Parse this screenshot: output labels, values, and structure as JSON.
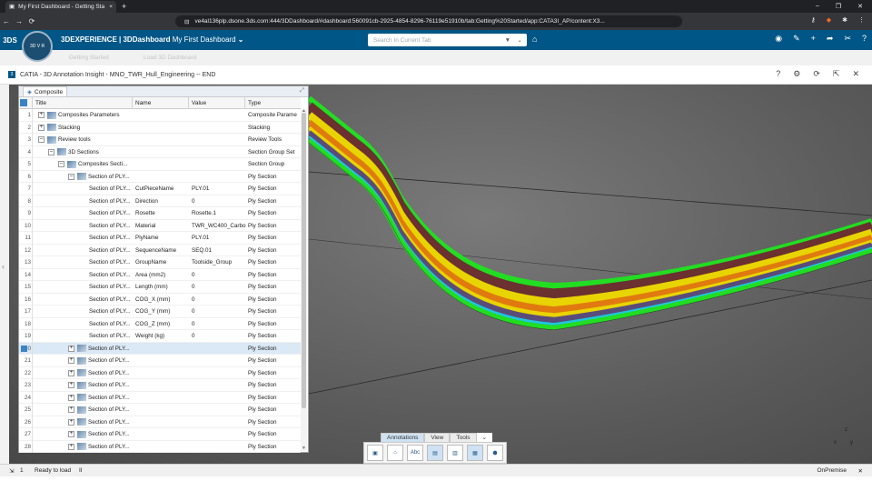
{
  "browser": {
    "tab_title": "My First Dashboard - Getting Sta",
    "tab_close": "×",
    "new_tab": "+",
    "url": "ve4al136plp.dsone.3ds.com:444/3DDashboard/#dashboard:560091cb-2925-4854-8296-76119e51910b/tab:Getting%20Started/app:CATA3I_AP/content:X3...",
    "minimize": "–",
    "maximize": "❐",
    "close": "✕"
  },
  "header": {
    "ds_logo": "3DS",
    "compass_label": "3D V R",
    "brand": "3DEXPERIENCE | 3DDashboard",
    "dashboard_name": "My First Dashboard",
    "search_placeholder": "Search In Current Tab"
  },
  "dashboard_tabs": {
    "tab1": "Getting Started",
    "tab2": "Load 3D Dashboard"
  },
  "app": {
    "title": "CATIA - 3D Annotation Insight - MNO_TWR_Hull_Engineering -- END",
    "help": "?",
    "settings": "⚙",
    "refresh": "⟳",
    "pin": "⇱",
    "close": "✕"
  },
  "panel": {
    "tab": "Composite",
    "columns": [
      "Title",
      "Name",
      "Value",
      "Type"
    ],
    "rows": [
      {
        "num": "1",
        "title": "Composites Parameters",
        "name": "",
        "value": "",
        "type": "Composite Parame",
        "level": 1,
        "expander": "+"
      },
      {
        "num": "2",
        "title": "Stacking",
        "name": "",
        "value": "",
        "type": "Stacking",
        "level": 1,
        "expander": "+"
      },
      {
        "num": "3",
        "title": "Review tools",
        "name": "",
        "value": "",
        "type": "Review Tools",
        "level": 1,
        "expander": "–"
      },
      {
        "num": "4",
        "title": "3D Sections",
        "name": "",
        "value": "",
        "type": "Section Group Set",
        "level": 2,
        "expander": "–"
      },
      {
        "num": "5",
        "title": "Composites Secti...",
        "name": "",
        "value": "",
        "type": "Section Group",
        "level": 3,
        "expander": "–"
      },
      {
        "num": "6",
        "title": "Section of PLY...",
        "name": "",
        "value": "",
        "type": "Ply Section",
        "level": 4,
        "expander": "–"
      },
      {
        "num": "7",
        "title": "Section of PLY...",
        "name": "CutPieceName",
        "value": "PLY.01",
        "type": "Ply Section",
        "level": 5,
        "expander": ""
      },
      {
        "num": "8",
        "title": "Section of PLY...",
        "name": "Direction",
        "value": "0",
        "type": "Ply Section",
        "level": 5,
        "expander": ""
      },
      {
        "num": "9",
        "title": "Section of PLY...",
        "name": "Rosette",
        "value": "Rosette.1",
        "type": "Ply Section",
        "level": 5,
        "expander": ""
      },
      {
        "num": "10",
        "title": "Section of PLY...",
        "name": "Material",
        "value": "TWR_WC400_Carbo",
        "type": "Ply Section",
        "level": 5,
        "expander": ""
      },
      {
        "num": "11",
        "title": "Section of PLY...",
        "name": "PlyName",
        "value": "PLY.01",
        "type": "Ply Section",
        "level": 5,
        "expander": ""
      },
      {
        "num": "12",
        "title": "Section of PLY...",
        "name": "SequenceName",
        "value": "SEQ.01",
        "type": "Ply Section",
        "level": 5,
        "expander": ""
      },
      {
        "num": "13",
        "title": "Section of PLY...",
        "name": "GroupName",
        "value": "Toolside_Group",
        "type": "Ply Section",
        "level": 5,
        "expander": ""
      },
      {
        "num": "14",
        "title": "Section of PLY...",
        "name": "Area (mm2)",
        "value": "0",
        "type": "Ply Section",
        "level": 5,
        "expander": ""
      },
      {
        "num": "15",
        "title": "Section of PLY...",
        "name": "Length (mm)",
        "value": "0",
        "type": "Ply Section",
        "level": 5,
        "expander": ""
      },
      {
        "num": "16",
        "title": "Section of PLY...",
        "name": "COG_X (mm)",
        "value": "0",
        "type": "Ply Section",
        "level": 5,
        "expander": ""
      },
      {
        "num": "17",
        "title": "Section of PLY...",
        "name": "COG_Y (mm)",
        "value": "0",
        "type": "Ply Section",
        "level": 5,
        "expander": ""
      },
      {
        "num": "18",
        "title": "Section of PLY...",
        "name": "COG_Z (mm)",
        "value": "0",
        "type": "Ply Section",
        "level": 5,
        "expander": ""
      },
      {
        "num": "19",
        "title": "Section of PLY...",
        "name": "Weight (kg)",
        "value": "0",
        "type": "Ply Section",
        "level": 5,
        "expander": ""
      },
      {
        "num": "20",
        "title": "Section of PLY...",
        "name": "",
        "value": "",
        "type": "Ply Section",
        "level": 4,
        "expander": "+",
        "selected": true
      },
      {
        "num": "21",
        "title": "Section of PLY...",
        "name": "",
        "value": "",
        "type": "Ply Section",
        "level": 4,
        "expander": "+"
      },
      {
        "num": "22",
        "title": "Section of PLY...",
        "name": "",
        "value": "",
        "type": "Ply Section",
        "level": 4,
        "expander": "+"
      },
      {
        "num": "23",
        "title": "Section of PLY...",
        "name": "",
        "value": "",
        "type": "Ply Section",
        "level": 4,
        "expander": "+"
      },
      {
        "num": "24",
        "title": "Section of PLY...",
        "name": "",
        "value": "",
        "type": "Ply Section",
        "level": 4,
        "expander": "+"
      },
      {
        "num": "25",
        "title": "Section of PLY...",
        "name": "",
        "value": "",
        "type": "Ply Section",
        "level": 4,
        "expander": "+"
      },
      {
        "num": "26",
        "title": "Section of PLY...",
        "name": "",
        "value": "",
        "type": "Ply Section",
        "level": 4,
        "expander": "+"
      },
      {
        "num": "27",
        "title": "Section of PLY...",
        "name": "",
        "value": "",
        "type": "Ply Section",
        "level": 4,
        "expander": "+"
      },
      {
        "num": "28",
        "title": "Section of PLY...",
        "name": "",
        "value": "",
        "type": "Ply Section",
        "level": 4,
        "expander": "+"
      }
    ]
  },
  "toolbar": {
    "tabs": [
      "Annotations",
      "View",
      "Tools"
    ],
    "active_tab": "Annotations",
    "buttons": [
      "Abc"
    ]
  },
  "axis": {
    "z": "z",
    "x": "x",
    "y": "y"
  },
  "status": {
    "count": "1",
    "message": "Ready to load",
    "pause": "II",
    "mode": "OnPremise"
  },
  "colors": {
    "ds_blue": "#005686",
    "ply_green": "#22dd22",
    "ply_brown": "#6b3030",
    "ply_yellow": "#e8d400",
    "ply_orange": "#e07a10",
    "ply_purple": "#5a4c7a",
    "ply_cyan": "#1ec6e0"
  }
}
